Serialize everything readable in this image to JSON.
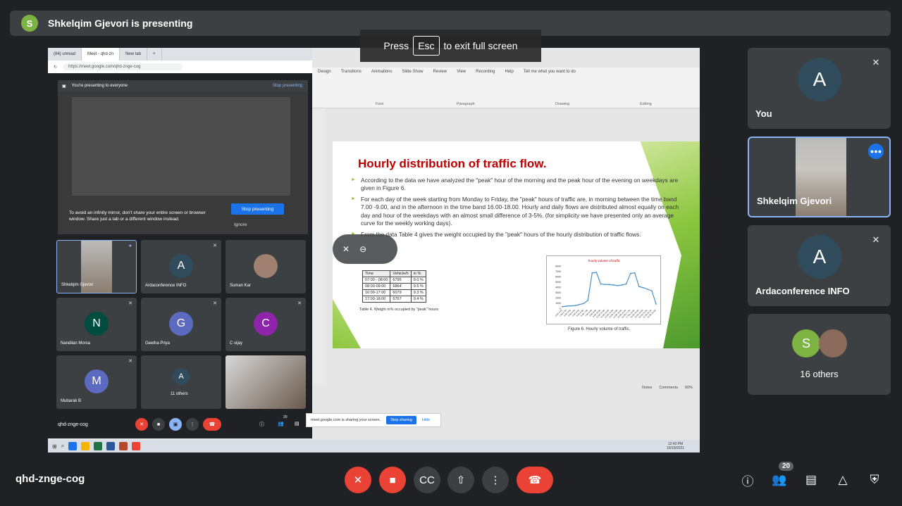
{
  "presenting": {
    "initial": "S",
    "text": "Shkelqim Gjevori is presenting"
  },
  "esc_banner": {
    "before": "Press",
    "key": "Esc",
    "after": "to exit full screen"
  },
  "browser": {
    "tabs": [
      "(84) unread",
      "Meet - qhd-zn",
      "New tab"
    ],
    "url": "https://meet.google.com/qhd-znge-cog",
    "present_bar": {
      "text": "You're presenting to everyone",
      "stop": "Stop presenting"
    },
    "mirror": {
      "warning": "To avoid an infinity mirror, don't share your entire screen or browser window. Share just a tab or a different window instead.",
      "stop_button": "Stop presenting",
      "ignore": "Ignore"
    },
    "tiles": [
      {
        "name": "Shkelqim Gjevori",
        "initial": "",
        "color": ""
      },
      {
        "name": "Ardaconference INFO",
        "initial": "A",
        "color": "#2f4b5c"
      },
      {
        "name": "Suman Kar",
        "initial": "",
        "color": ""
      },
      {
        "name": "Nandilan Morsa",
        "initial": "N",
        "color": "#004d40"
      },
      {
        "name": "Geetha Priya",
        "initial": "G",
        "color": "#5c6bc0"
      },
      {
        "name": "C vijay",
        "initial": "C",
        "color": "#8e24aa"
      },
      {
        "name": "Mubarak B",
        "initial": "M",
        "color": "#5c6bc0"
      },
      {
        "name": "11 others",
        "initial": "A",
        "color": "#2f4b5c"
      }
    ],
    "meeting_code": "qhd-zngе-cog",
    "people_count": "20"
  },
  "ppt": {
    "ribbon_tabs": [
      "Design",
      "Transitions",
      "Animations",
      "Slide Show",
      "Review",
      "View",
      "Recording",
      "Help",
      "Tell me what you want to do"
    ],
    "groups": [
      "Font",
      "Paragraph",
      "Drawing",
      "Editing"
    ],
    "slide": {
      "title": "Hourly distribution of traffic flow.",
      "bullets": [
        "According to the data we have analyzed the \"peak\" hour of the morning and the peak hour of the evening on weekdays are given in Figure 6.",
        "For each day of the week starting from Monday to Friday, the \"peak\" hours of traffic are, in morning between the time band 7.00 -9.00, and in the afternoon in the time band 16.00-18.00. Hourly and daily flows are distributed almost equally on each day and hour of the weekdays with an almost small difference of 3-5%. (for simplicity we have presented only an average curve for the weekly working days).",
        "From the data Table 4 gives the weight occupied by the \"peak\" hours of the hourly distribution of traffic flows."
      ],
      "table": {
        "headers": [
          "Time",
          "Vehicle/h",
          "in %"
        ],
        "rows": [
          [
            "07:00 - 08:00",
            "6795",
            "9.0 %"
          ],
          [
            "08:00-09:00",
            "6864",
            "9.5 %"
          ],
          [
            "16:00-17:00",
            "6079",
            "9.3 %"
          ],
          [
            "17:00-18:00",
            "6767",
            "9.4 %"
          ]
        ],
        "caption": "Table 4. Weight in% occupied by \"peak\" hours"
      },
      "figure_caption": "Figure 6. Hourly volume of traffic."
    },
    "status": {
      "notes": "Notes",
      "comments": "Comments",
      "zoom": "60%"
    },
    "share_bar": {
      "text": "meet.google.com is sharing your screen.",
      "stop": "Stop sharing",
      "hide": "Hide"
    },
    "clock": {
      "time": "12:43 PM",
      "date": "10/19/2021"
    }
  },
  "chart_data": {
    "type": "line",
    "title": "hourly volume of traffic",
    "x": [
      "0:00-1:00",
      "1:00-2:00",
      "2:00-3:00",
      "3:00-4:00",
      "4:00-5:00",
      "5:00-6:00",
      "6:00-7:00",
      "7:00-8:00",
      "8:00-9:00",
      "9:00-10:00",
      "10:00-11:00",
      "11:00-12:00",
      "12:00-13:00",
      "13:00-14:00",
      "14:00-15:00",
      "15:00-16:00",
      "16:00-17:00",
      "17:00-18:00",
      "18:00-19:00",
      "19:00-20:00",
      "20:00-21:00",
      "21:00-22:00",
      "22:00-23:00"
    ],
    "series": [
      {
        "values": [
          300,
          400,
          450,
          500,
          700,
          900,
          1500,
          6700,
          6800,
          4600,
          4500,
          4500,
          4400,
          4300,
          4400,
          4600,
          6600,
          6700,
          4100,
          3900,
          3600,
          3300,
          800
        ]
      }
    ],
    "ylim": [
      0,
      8000
    ],
    "yticks": [
      0,
      1000,
      2000,
      3000,
      4000,
      5000,
      6000,
      7000,
      8000
    ]
  },
  "right_panel": {
    "tiles": [
      {
        "name": "You",
        "initial": "A"
      },
      {
        "name": "Shkelqim Gjevori",
        "initial": ""
      },
      {
        "name": "Ardaconference INFO",
        "initial": "A"
      },
      {
        "name": "16 others",
        "initial": "S"
      }
    ]
  },
  "bottom": {
    "meeting_code": "qhd-znge-cog",
    "people_badge": "20"
  }
}
